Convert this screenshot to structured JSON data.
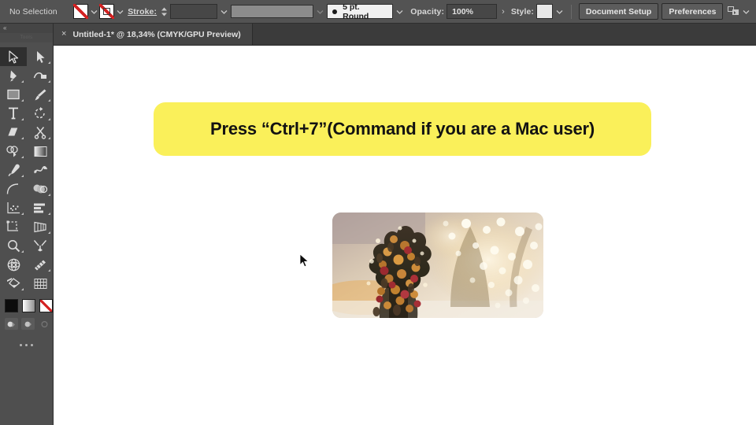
{
  "control_bar": {
    "selection_status": "No Selection",
    "fill_swatch": "none-swatch",
    "stroke_swatch": "none-swatch",
    "stroke_label": "Stroke:",
    "stroke_weight_value": "",
    "variable_width_profile": "",
    "brush_definition": "5 pt. Round",
    "opacity_label": "Opacity:",
    "opacity_value": "100%",
    "style_label": "Style:",
    "document_setup_label": "Document Setup",
    "preferences_label": "Preferences",
    "arrange_documents_icon": "arrange-documents-icon"
  },
  "tab_bar": {
    "close_glyph": "×",
    "document_title": "Untitled-1* @ 18,34% (CMYK/GPU Preview)"
  },
  "tools": {
    "panel_tab_label": "Tools",
    "collapse_glyph": "«",
    "overflow_glyph": "...",
    "items": [
      {
        "name": "selection-tool",
        "active": true,
        "more": false
      },
      {
        "name": "direct-selection-tool",
        "active": false,
        "more": true
      },
      {
        "name": "pen-tool",
        "active": false,
        "more": true
      },
      {
        "name": "curvature-tool",
        "active": false,
        "more": true
      },
      {
        "name": "rectangle-tool",
        "active": false,
        "more": true
      },
      {
        "name": "paintbrush-tool",
        "active": false,
        "more": true
      },
      {
        "name": "type-tool",
        "active": false,
        "more": true
      },
      {
        "name": "rotate-tool",
        "active": false,
        "more": true
      },
      {
        "name": "eraser-tool",
        "active": false,
        "more": true
      },
      {
        "name": "scissors-tool",
        "active": false,
        "more": true
      },
      {
        "name": "shape-builder-tool",
        "active": false,
        "more": true
      },
      {
        "name": "gradient-tool",
        "active": false,
        "more": false
      },
      {
        "name": "eyedropper-tool",
        "active": false,
        "more": true
      },
      {
        "name": "blend-tool",
        "active": false,
        "more": false
      },
      {
        "name": "arc-tool",
        "active": false,
        "more": false
      },
      {
        "name": "blob-brush-tool",
        "active": false,
        "more": true
      },
      {
        "name": "symbol-sprayer-tool",
        "active": false,
        "more": true
      },
      {
        "name": "column-graph-tool",
        "active": false,
        "more": true
      },
      {
        "name": "artboard-tool",
        "active": false,
        "more": false
      },
      {
        "name": "perspective-grid-tool",
        "active": false,
        "more": true
      },
      {
        "name": "zoom-tool",
        "active": false,
        "more": true
      },
      {
        "name": "free-transform-tool",
        "active": false,
        "more": false
      },
      {
        "name": "mesh-tool",
        "active": false,
        "more": false
      },
      {
        "name": "width-tool",
        "active": false,
        "more": true
      },
      {
        "name": "live-paint-bucket-tool",
        "active": false,
        "more": true
      },
      {
        "name": "perspective-selection-tool",
        "active": false,
        "more": false
      }
    ],
    "swatches": [
      {
        "name": "fill-color-swatch",
        "value": "#0c0c0c"
      },
      {
        "name": "gradient-swatch",
        "value": "#ffffff"
      },
      {
        "name": "none-swatch",
        "value": "#ffffff"
      }
    ],
    "draw_modes": [
      {
        "name": "draw-normal-mode",
        "enabled": true
      },
      {
        "name": "draw-behind-mode",
        "enabled": true
      },
      {
        "name": "draw-inside-mode",
        "enabled": false
      }
    ]
  },
  "canvas": {
    "banner_text": "Press “Ctrl+7”(Command if you are a Mac user)",
    "banner_color": "#faf05a",
    "banner_text_color": "#121212",
    "image_alt": "christmas-tree-with-bokeh-lights-photo",
    "cursor": "arrow-cursor"
  }
}
